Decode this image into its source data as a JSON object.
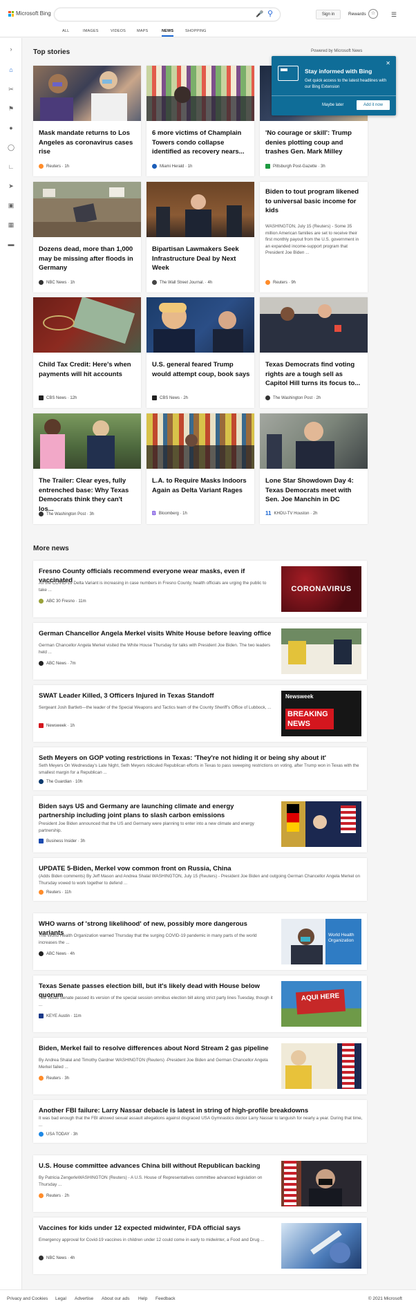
{
  "header": {
    "brand": "Microsoft Bing",
    "signin": "Sign in",
    "rewards": "Rewards"
  },
  "nav": [
    "ALL",
    "IMAGES",
    "VIDEOS",
    "MAPS",
    "NEWS",
    "SHOPPING"
  ],
  "top_stories": {
    "title": "Top stories",
    "powered": "Powered by Microsoft News"
  },
  "popup": {
    "title": "Stay informed with Bing",
    "text": "Get quick access to the latest headlines with our Bing Extension",
    "later": "Maybe later",
    "add": "Add it now"
  },
  "cards": [
    {
      "title": "Mask mandate returns to Los Angeles as coronavirus cases rise",
      "source": "Reuters · 1h",
      "icon_color": "#ff8c2a"
    },
    {
      "title": "6 more victims of Champlain Towers condo collapse identified as recovery nears...",
      "source": "Miami Herald · 1h",
      "icon_color": "#1b5db8"
    },
    {
      "title": "'No courage or skill': Trump denies plotting coup and trashes Gen. Mark Milley",
      "source": "Pittsburgh Post-Gazette · 3h",
      "icon_color": "#1d9a40"
    },
    {
      "title": "Dozens dead, more than 1,000 may be missing after floods in Germany",
      "source": "NBC News · 1h",
      "icon_color": "#333"
    },
    {
      "title": "Bipartisan Lawmakers Seek Infrastructure Deal by Next Week",
      "source": "The Wall Street Journal. · 4h",
      "icon_color": "#444"
    },
    {
      "title": "Biden to tout program likened to universal basic income for kids",
      "snippet": "WASHINGTON, July 15 (Reuters) - Some 35 million American families are set to receive their first monthly payout from the U.S. government in an expanded income-support program that President Joe Biden ...",
      "source": "Reuters · 9h",
      "icon_color": "#ff8c2a"
    },
    {
      "title": "Child Tax Credit: Here's when payments will hit accounts",
      "source": "CBS News · 12h",
      "icon_color": "#222"
    },
    {
      "title": "U.S. general feared Trump would attempt coup, book says",
      "source": "CBS News · 2h",
      "icon_color": "#222"
    },
    {
      "title": "Texas Democrats find voting rights are a tough sell as Capitol Hill turns its focus to...",
      "source": "The Washington Post · 2h",
      "icon_color": "#333"
    },
    {
      "title": "The Trailer: Clear eyes, fully entrenched base: Why Texas Democrats think they can't los...",
      "source": "The Washington Post · 3h",
      "icon_color": "#333"
    },
    {
      "title": "L.A. to Require Masks Indoors Again as Delta Variant Rages",
      "source": "Bloomberg · 1h",
      "icon_color": "#5a2ad9"
    },
    {
      "title": "Lone Star Showdown Day 4: Texas Democrats meet with Sen. Joe Manchin in DC",
      "source": "KHOU-TV Houston · 2h",
      "icon_color": "#1a66d2"
    }
  ],
  "more_news": {
    "title": "More news",
    "items": [
      {
        "title": "Fresno County officials recommend everyone wear masks, even if vaccinated",
        "snippet": "As the COVID-19 Delta Variant is increasing in case numbers in Fresno County, health officials are urging the public to take ...",
        "source": "ABC 30 Fresno · 11m",
        "image_text": "CORONAVIRUS"
      },
      {
        "title": "German Chancellor Angela Merkel visits White House before leaving office",
        "snippet": "German Chancellor Angela Merkel visited the White House Thursday for talks with President Joe Biden. The two leaders held ...",
        "source": "ABC News · 7m"
      },
      {
        "title": "SWAT Leader Killed, 3 Officers Injured in Texas Standoff",
        "snippet": "Sergeant Josh Bartlett—the leader of the Special Weapons and Tactics team of the County Sheriff's Office of Lubbock, ...",
        "source": "Newsweek · 1h",
        "image_brand": "Newsweek",
        "image_text": "BREAKING NEWS"
      },
      {
        "title": "Seth Meyers on GOP voting restrictions in Texas: 'They're not hiding it or being shy about it'",
        "snippet": "Seth Meyers On Wednesday's Late Night, Seth Meyers ridiculed Republican efforts in Texas to pass sweeping restrictions on voting, after Trump won in Texas with the smallest margin for a Republican ...",
        "source": "The Guardian · 10h"
      },
      {
        "title": "Biden says US and Germany are launching climate and energy partnership including joint plans to slash carbon emissions",
        "snippet": "President Joe Biden announced that the US and Germany were planning to enter into a new climate and energy partnership.",
        "source": "Business Insider · 3h"
      },
      {
        "title": "UPDATE 5-Biden, Merkel vow common front on Russia, China",
        "snippet": "(Adds Biden comments) By Jeff Mason and Andrea Shalal WASHINGTON, July 15 (Reuters) - President Joe Biden and outgoing German Chancellor Angela Merkel on Thursday vowed to work together to defend ...",
        "source": "Reuters · 11h"
      },
      {
        "title": "WHO warns of 'strong likelihood' of new, possibly more dangerous variants",
        "snippet": "The World Health Organization warned Thursday that the surging COVID-19 pandemic in many parts of the world increases the ...",
        "source": "ABC News · 4h",
        "image_text": "World Health Organization"
      },
      {
        "title": "Texas Senate passes election bill, but it's likely dead with House below quorum",
        "snippet": "The Texas Senate passed its version of the special session omnibus election bill along strict party lines Tuesday, though it ...",
        "source": "KEYE Austin · 11m",
        "image_text": "AQUI HERE"
      },
      {
        "title": "Biden, Merkel fail to resolve differences about Nord Stream 2 gas pipeline",
        "snippet": "By Andrea Shalal and Timothy Gardner WASHINGTON (Reuters) -President Joe Biden and German Chancellor Angela Merkel failed ...",
        "source": "Reuters · 3h"
      },
      {
        "title": "Another FBI failure: Larry Nassar debacle is latest in string of high-profile breakdowns",
        "snippet": "It was bad enough that the FBI allowed sexual assault allegations against disgraced USA Gymnastics doctor Larry Nassar to languish for nearly a year. During that time, ...",
        "source": "USA TODAY · 3h"
      },
      {
        "title": "U.S. House committee advances China bill without Republican backing",
        "snippet": "By Patricia ZengerleWASHINGTON (Reuters) - A U.S. House of Representatives committee advanced legislation on Thursday ...",
        "source": "Reuters · 2h"
      },
      {
        "title": "Vaccines for kids under 12 expected midwinter, FDA official says",
        "snippet": "Emergency approval for Covid-19 vaccines in children under 12 could come in early to midwinter, a Food and Drug ...",
        "source": "NBC News · 4h"
      }
    ]
  },
  "footer": {
    "links": [
      "Privacy and Cookies",
      "Legal",
      "Advertise",
      "About our ads",
      "Help",
      "Feedback"
    ],
    "copyright": "© 2021 Microsoft"
  }
}
